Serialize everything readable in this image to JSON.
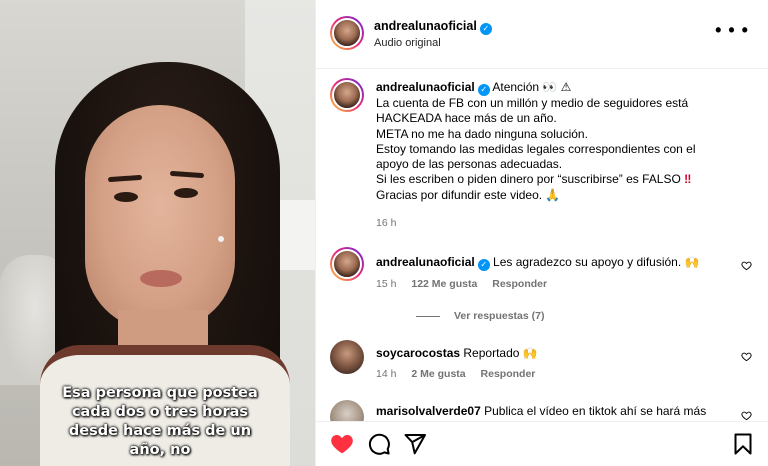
{
  "video": {
    "caption_lines": [
      "Esa persona que postea",
      "cada dos o tres horas",
      "desde hace más de un",
      "año, no"
    ]
  },
  "header": {
    "username": "andrealunaoficial",
    "audio": "Audio original",
    "more_icon": "more-horizontal-icon"
  },
  "post_caption": {
    "username": "andrealunaoficial",
    "first": "Atención 👀 ⚠",
    "lines": [
      "La cuenta de FB con un millón y medio de seguidores está",
      "HACKEADA hace más de un año.",
      "META no me ha dado ninguna solución.",
      "Estoy tomando las medidas legales correspondientes con el",
      "apoyo de las personas adecuadas.",
      "Si les escriben o piden dinero por “suscribirse” es FALSO",
      "Gracias por difundir este video. 🙏"
    ],
    "alert": "‼",
    "time": "16 h"
  },
  "comments": [
    {
      "username": "andrealunaoficial",
      "text": "Les agradezco su apoyo y difusión. 🙌",
      "time": "15 h",
      "likes": "122 Me gusta",
      "reply": "Responder",
      "view_replies": "Ver respuestas (7)"
    },
    {
      "username": "soycarocostas",
      "text": "Reportado 🙌",
      "time": "14 h",
      "likes": "2 Me gusta",
      "reply": "Responder"
    },
    {
      "username": "marisolvalverde07",
      "text": "Publica el vídeo en tiktok ahí se hará más"
    }
  ],
  "actions": {
    "like_icon": "heart-filled-icon",
    "comment_icon": "comment-icon",
    "share_icon": "share-icon",
    "save_icon": "bookmark-icon",
    "like_color": "#ff3040"
  }
}
